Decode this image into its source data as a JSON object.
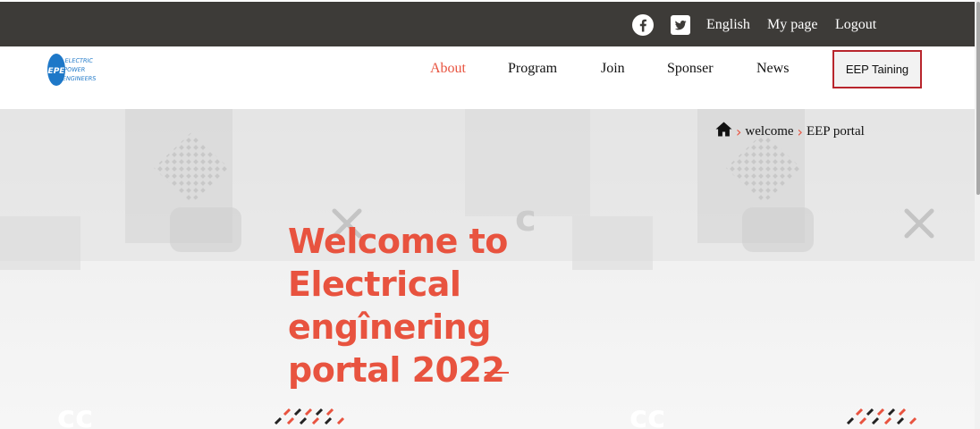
{
  "topbar": {
    "social": [
      "facebook-icon",
      "twitter-icon"
    ],
    "language": "English",
    "my_page": "My page",
    "logout": "Logout"
  },
  "logo": {
    "mark": "EPE",
    "lines": [
      "ELECTRIC",
      "POWER",
      "ENGINEERS"
    ]
  },
  "nav": {
    "items": [
      "About",
      "Program",
      "Join",
      "Sponser",
      "News"
    ],
    "active": "About",
    "training_button": "EEP Taining"
  },
  "breadcrumb": {
    "home_icon": "home-icon",
    "items": [
      "welcome",
      "EEP portal"
    ]
  },
  "hero": {
    "title_lines": [
      "Welcome to Electrical",
      "engînering",
      "portal 2022"
    ]
  },
  "colors": {
    "accent": "#e8533f",
    "topbar": "#3d3b38",
    "button_border": "#b8252c"
  }
}
